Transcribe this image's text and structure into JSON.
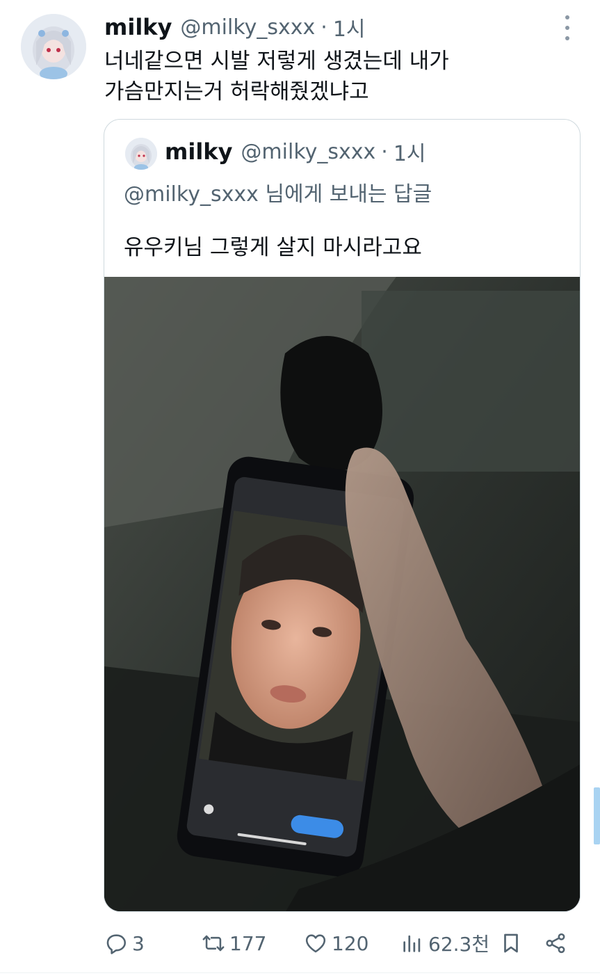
{
  "tweet": {
    "author_name": "milky",
    "handle": "@milky_sxxx",
    "separator": "·",
    "time": "1시",
    "text_lines": [
      "너네같으면 시발 저렇게 생겼는데 내가",
      "가슴만지는거 허락해줬겠냐고"
    ]
  },
  "quoted": {
    "author_name": "milky",
    "handle": "@milky_sxxx",
    "separator": "·",
    "time": "1시",
    "replying_to": "@milky_sxxx 님에게 보내는 답글",
    "text": "유우키님 그렇게 살지 마시라고요"
  },
  "actions": {
    "replies": "3",
    "retweets": "177",
    "likes": "120",
    "views": "62.3천"
  },
  "icons": {
    "more": "more-vertical-icon",
    "reply": "reply-icon",
    "retweet": "retweet-icon",
    "like": "heart-icon",
    "views": "views-icon",
    "bookmark": "bookmark-icon",
    "share": "share-icon"
  },
  "colors": {
    "text_primary": "#0f1419",
    "text_secondary": "#536471",
    "border": "#cfd9de"
  }
}
